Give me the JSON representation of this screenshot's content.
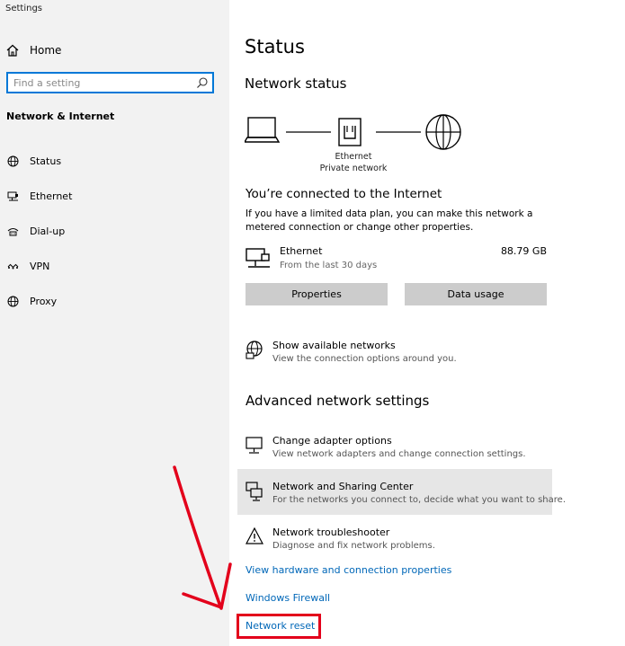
{
  "window": {
    "title": "Settings"
  },
  "sidebar": {
    "home_label": "Home",
    "search_placeholder": "Find a setting",
    "section_title": "Network & Internet",
    "items": [
      {
        "label": "Status",
        "icon": "globe-icon"
      },
      {
        "label": "Ethernet",
        "icon": "ethernet-icon"
      },
      {
        "label": "Dial-up",
        "icon": "dialup-icon"
      },
      {
        "label": "VPN",
        "icon": "vpn-icon"
      },
      {
        "label": "Proxy",
        "icon": "globe-icon"
      }
    ]
  },
  "main": {
    "title": "Status",
    "network_status_heading": "Network status",
    "diagram": {
      "adapter_label": "Ethernet",
      "network_label": "Private network"
    },
    "connected_heading": "You’re connected to the Internet",
    "connected_desc": "If you have a limited data plan, you can make this network a metered connection or change other properties.",
    "connection": {
      "name": "Ethernet",
      "sub": "From the last 30 days",
      "usage": "88.79 GB"
    },
    "buttons": {
      "properties": "Properties",
      "data_usage": "Data usage"
    },
    "show_networks": {
      "title": "Show available networks",
      "desc": "View the connection options around you."
    },
    "advanced_heading": "Advanced network settings",
    "advanced_items": [
      {
        "title": "Change adapter options",
        "desc": "View network adapters and change connection settings.",
        "icon": "monitor-icon"
      },
      {
        "title": "Network and Sharing Center",
        "desc": "For the networks you connect to, decide what you want to share.",
        "icon": "sharing-icon"
      },
      {
        "title": "Network troubleshooter",
        "desc": "Diagnose and fix network problems.",
        "icon": "warning-icon"
      }
    ],
    "links": {
      "hardware": "View hardware and connection properties",
      "firewall": "Windows Firewall",
      "reset": "Network reset"
    }
  },
  "annotation": {
    "color": "#e3001b"
  },
  "colors": {
    "accent": "#0078d7",
    "link": "#0067b8",
    "sidebar_bg": "#f2f2f2"
  }
}
